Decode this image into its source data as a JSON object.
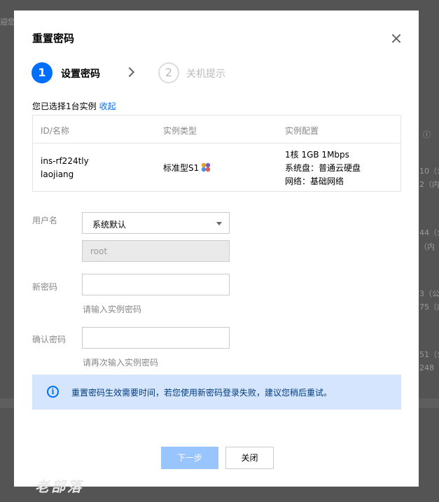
{
  "background": {
    "fragments": [
      {
        "text": "迎您"
      },
      {
        "text": "10（公"
      },
      {
        "text": "2（内"
      },
      {
        "text": "44（公"
      },
      {
        "text": "（内"
      },
      {
        "text": "3（公"
      },
      {
        "text": "75（内"
      },
      {
        "text": "51（公"
      },
      {
        "text": "248（内"
      }
    ]
  },
  "modal": {
    "title": "重置密码",
    "steps": [
      {
        "number": "1",
        "label": "设置密码"
      },
      {
        "number": "2",
        "label": "关机提示"
      }
    ],
    "selected_text": "您已选择1台实例",
    "collapse_label": "收起",
    "table": {
      "headers": [
        "ID/名称",
        "实例类型",
        "实例配置"
      ],
      "row": {
        "id": "ins-rf224tly",
        "name": "laojiang",
        "type": "标准型S1",
        "config_line1": "1核 1GB 1Mbps",
        "config_line2": "系统盘：普通云硬盘",
        "config_line3": "网络：基础网络"
      }
    },
    "username_label": "用户名",
    "username_select_value": "系统默认",
    "username_readonly": "root",
    "new_password_label": "新密码",
    "new_password_value": "",
    "new_password_hint": "请输入实例密码",
    "confirm_password_label": "确认密码",
    "confirm_password_value": "",
    "confirm_password_hint": "请再次输入实例密码",
    "notice_text": "重置密码生效需要时间，若您使用新密码登录失败，建议您稍后重试。",
    "next_button": "下一步",
    "close_button": "关闭",
    "watermark": "老部落",
    "colors": {
      "primary": "#006eff",
      "primary_disabled": "#99c5ff",
      "notice_bg": "#d4e5fd",
      "notice_text": "#003b80"
    }
  }
}
